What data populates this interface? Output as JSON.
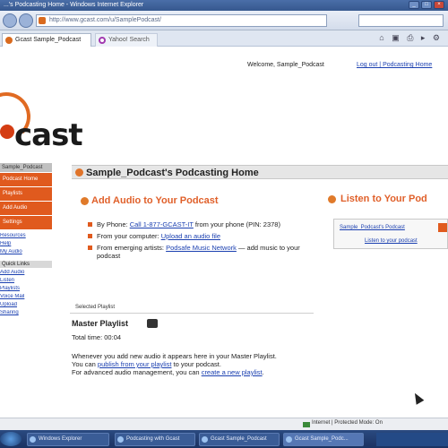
{
  "window": {
    "title": "...'s Podcasting Home - Windows Internet Explorer"
  },
  "address": {
    "url": "http://www.gcast.com/u/SamplePodcast/"
  },
  "tabs": [
    {
      "label": "Gcast Sample_Podcast"
    },
    {
      "label": "Yahoo! Search"
    }
  ],
  "header": {
    "welcome_text": "Welcome, Sample_Podcast",
    "welcome_link": "Log out | Podcasting Home"
  },
  "logo": {
    "text": "cast"
  },
  "sidebar": {
    "head": "Sample_Podcast",
    "items": [
      "Podcast Home",
      "Playlists",
      "Add Audio",
      "Settings"
    ],
    "links": [
      "Resources",
      "Help",
      "My Audio"
    ],
    "box_label": "Quick Links",
    "box_links": [
      "Add Audio",
      "Listen",
      "Playlists",
      "Voice Mail",
      "Upload",
      "Sharing"
    ]
  },
  "main": {
    "page_title": "Sample_Podcast's Podcasting Home",
    "add_title": "Add Audio to Your Podcast",
    "listen_title": "Listen to Your Pod",
    "add_items": [
      {
        "prefix": "By Phone: ",
        "link": "Call 1-877-GCAST-IT",
        "rest": " from your phone (PIN: 2378)"
      },
      {
        "prefix": "From your computer: ",
        "link": "Upload an audio file",
        "rest": ""
      },
      {
        "prefix": "From emerging artists: ",
        "link": "Podsafe Music Network",
        "rest": " — add music to your podcast"
      }
    ],
    "listen_link_1": "Sample_Podcast's Podcast",
    "listen_link_2": "Listen to your podcast",
    "playlist_tab": "Selected Playlist",
    "master_playlist": "Master Playlist",
    "total_time": "Total time: 00:04",
    "playlist_p1": "Whenever you add new audio it appears here in your Master Playlist.",
    "playlist_p2_prefix": "You can ",
    "playlist_p2_link": "publish from your playlist",
    "playlist_p2_rest": " to your podcast.",
    "playlist_p3_prefix": "For advanced audio management, you can ",
    "playlist_p3_link": "create a new playlist",
    "playlist_p3_rest": "."
  },
  "statusbar": {
    "zone": "Internet | Protected Mode: On"
  },
  "taskbar": {
    "items": [
      "Windows Explorer",
      "Podcasting with Gcast",
      "Gcast Sample_Podcast",
      "Gcast Sample_Podc..."
    ]
  }
}
